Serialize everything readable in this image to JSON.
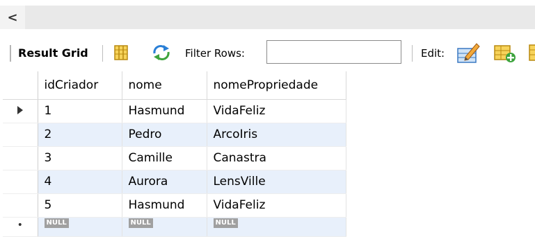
{
  "scrollbar": {
    "left_arrow": "<"
  },
  "toolbar": {
    "result_grid_label": "Result Grid",
    "filter_label": "Filter Rows:",
    "filter_value": "",
    "edit_label": "Edit:"
  },
  "icons": {
    "grid_view": "form-grid-icon",
    "refresh": "refresh-arrows-icon",
    "edit": "edit-pencil-icon",
    "add_row": "add-row-icon",
    "more": "grid-icon"
  },
  "grid": {
    "columns": [
      "idCriador",
      "nome",
      "nomePropriedade"
    ],
    "rows": [
      [
        "1",
        "Hasmund",
        "VidaFeliz"
      ],
      [
        "2",
        "Pedro",
        "ArcoIris"
      ],
      [
        "3",
        "Camille",
        "Canastra"
      ],
      [
        "4",
        "Aurora",
        "LensVille"
      ],
      [
        "5",
        "Hasmund",
        "VidaFeliz"
      ]
    ],
    "new_row": [
      "NULL",
      "NULL",
      "NULL"
    ]
  },
  "colors": {
    "alt_row": "#e8f0fb",
    "null_badge": "#a0a0a0",
    "scroll_track": "#e9e9e9"
  }
}
